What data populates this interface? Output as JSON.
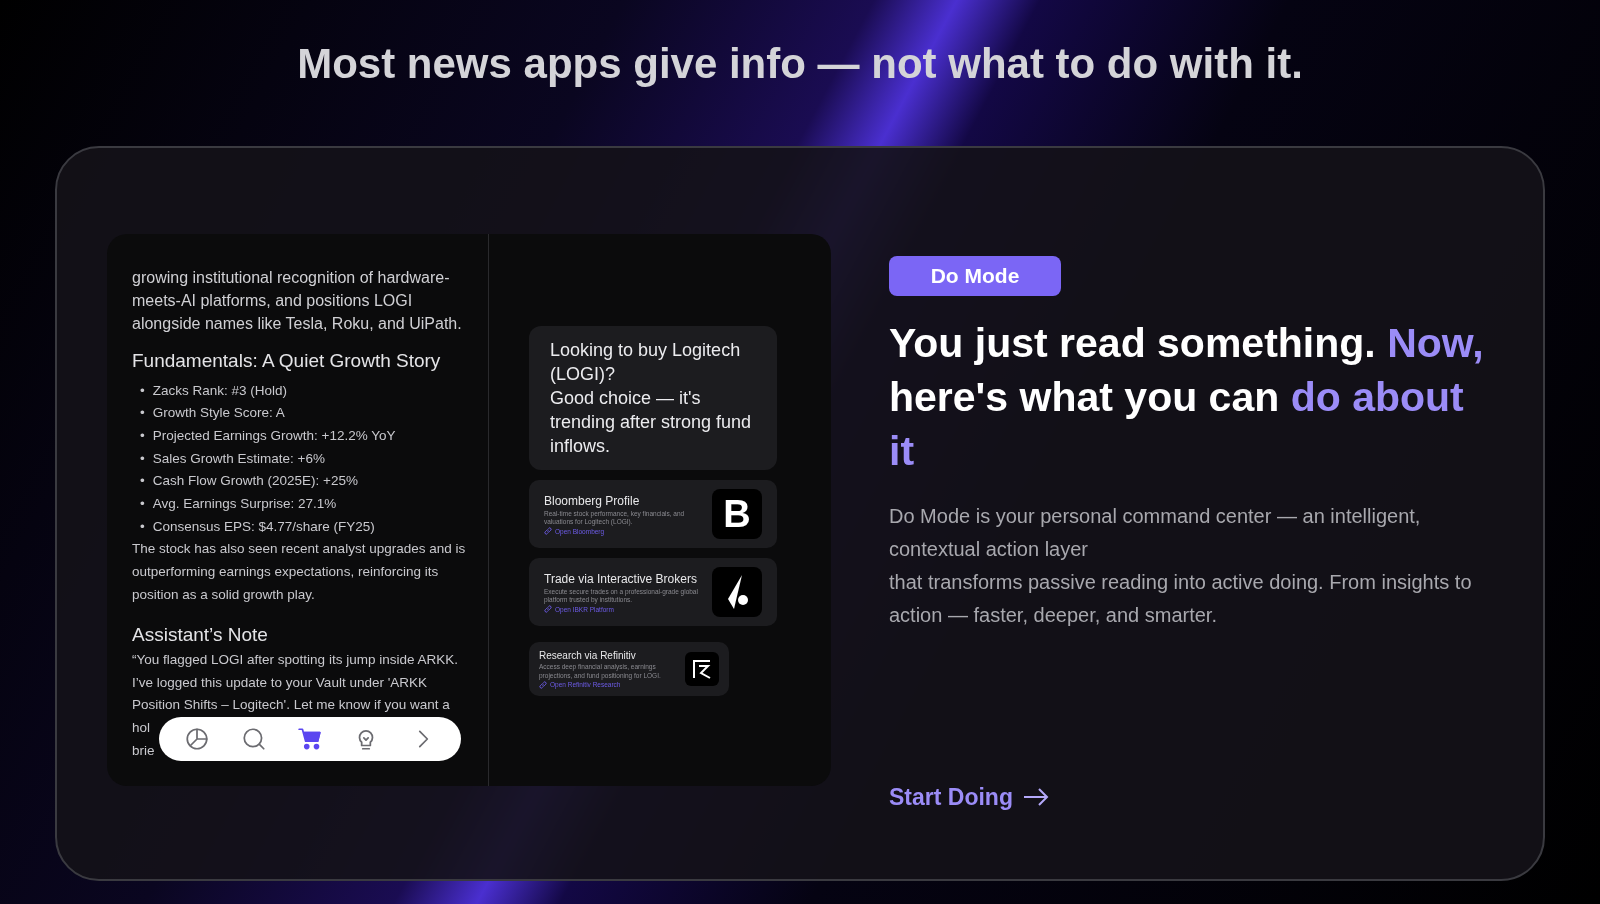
{
  "headline": "Most news apps give info — not what to do with it.",
  "preview": {
    "article_lines": [
      "growing institutional recognition of hardware-",
      "meets-AI platforms, and positions LOGI",
      "alongside names like Tesla, Roku, and UiPath."
    ],
    "section_title": "Fundamentals: A Quiet Growth Story",
    "bullet_marker": "•",
    "bullets": [
      "Zacks Rank: #3 (Hold)",
      "Growth Style Score: A",
      "Projected Earnings Growth: +12.2% YoY",
      "Sales Growth Estimate: +6%",
      "Cash Flow Growth (2025E): +25%",
      "Avg. Earnings Surprise: 27.1%",
      "Consensus EPS: $4.77/share (FY25)"
    ],
    "paragraph": "The stock has also seen recent analyst upgrades and is outperforming earnings expectations, reinforcing its position as a solid growth play.",
    "note_title": "Assistant’s Note",
    "note_lines": [
      "“You flagged LOGI after spotting its jump inside ARKK.",
      "I’ve logged this update to your Vault under 'ARKK",
      "Position Shifts – Logitech'. Let me know if you want a",
      "hol",
      "brie"
    ],
    "toolbar": [
      {
        "kind": "chart",
        "selected": false
      },
      {
        "kind": "search",
        "selected": false
      },
      {
        "kind": "cart",
        "selected": true
      },
      {
        "kind": "idea",
        "selected": false
      },
      {
        "kind": "next",
        "selected": false
      }
    ],
    "chat_bubble": "Looking to buy Logitech (LOGI)?\nGood choice — it's trending after strong fund inflows.",
    "cards": [
      {
        "title": "Bloomberg Profile",
        "description": "Real-time stock performance, key financials, and valuations for Logitech (LOGI).",
        "link": "Open Bloomberg",
        "logo": "B",
        "kind": "letter"
      },
      {
        "title": "Trade via Interactive Brokers",
        "description": "Execute secure trades on a professional-grade global platform trusted by institutions.",
        "link": "Open IBKR Platform",
        "kind": "ibkr"
      },
      {
        "title": "Research via Refinitiv",
        "description": "Access deep financial analysis, earnings projections, and fund positioning for LOGI.",
        "link": "Open Refinitiv Research",
        "kind": "refinitiv"
      }
    ]
  },
  "badge": "Do Mode",
  "title": "You just read something. **Now,** here's what you can **do about it**",
  "body_lines": [
    "Do Mode is your personal command center — an intelligent, contextual action layer",
    "that transforms passive reading into active doing. From insights to action — faster, deeper, and smarter."
  ],
  "cta": "Start Doing"
}
